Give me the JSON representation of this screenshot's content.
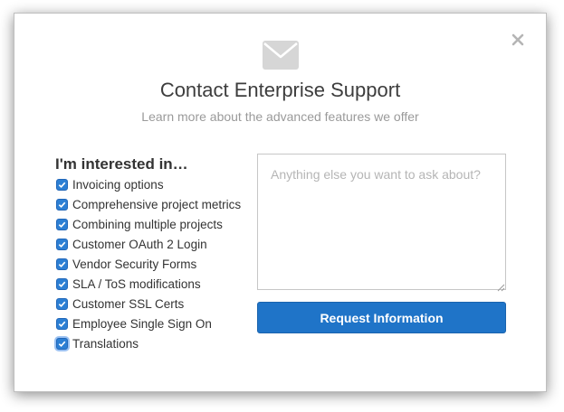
{
  "dialog": {
    "title": "Contact Enterprise Support",
    "subtitle": "Learn more about the advanced features we offer",
    "close_icon": "close-icon",
    "header_icon": "envelope-icon"
  },
  "interests": {
    "heading": "I'm interested in…",
    "options": [
      {
        "label": "Invoicing options",
        "checked": true
      },
      {
        "label": "Comprehensive project metrics",
        "checked": true
      },
      {
        "label": "Combining multiple projects",
        "checked": true
      },
      {
        "label": "Customer OAuth 2 Login",
        "checked": true
      },
      {
        "label": "Vendor Security Forms",
        "checked": true
      },
      {
        "label": "SLA / ToS modifications",
        "checked": true
      },
      {
        "label": "Customer SSL Certs",
        "checked": true
      },
      {
        "label": "Employee Single Sign On",
        "checked": true
      },
      {
        "label": "Translations",
        "checked": true,
        "focused": true
      }
    ]
  },
  "question": {
    "value": "",
    "placeholder": "Anything else you want to ask about?"
  },
  "submit": {
    "label": "Request Information"
  },
  "colors": {
    "accent": "#1f74c8",
    "checkbox": "#2c7fd4",
    "title_text": "#3d3d3d",
    "muted_text": "#9a9a9a"
  }
}
